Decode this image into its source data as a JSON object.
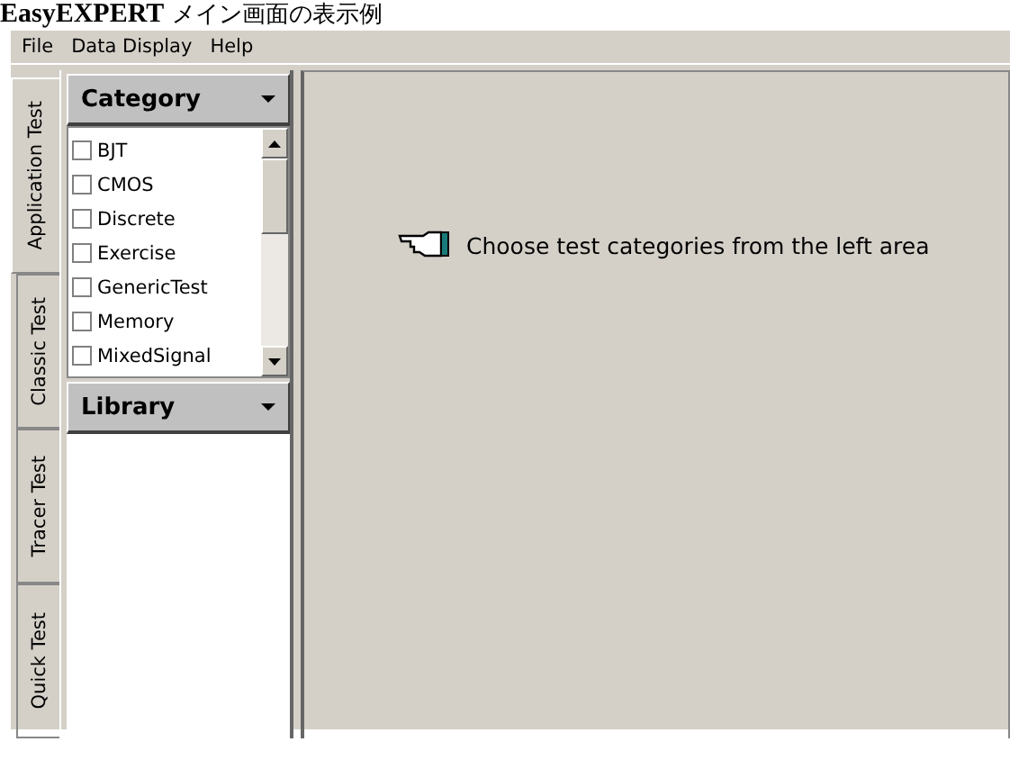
{
  "caption": "**EasyEXPERT** メイン画面の表示例",
  "menu": [
    "File",
    "Data Display",
    "Help"
  ],
  "tabs": [
    {
      "label": "Application Test",
      "selected": true
    },
    {
      "label": "Classic Test",
      "selected": false
    },
    {
      "label": "Tracer Test",
      "selected": false
    },
    {
      "label": "Quick Test",
      "selected": false
    }
  ],
  "category": {
    "title": "Category",
    "items": [
      {
        "label": "BJT",
        "checked": false
      },
      {
        "label": "CMOS",
        "checked": false
      },
      {
        "label": "Discrete",
        "checked": false
      },
      {
        "label": "Exercise",
        "checked": false
      },
      {
        "label": "GenericTest",
        "checked": false
      },
      {
        "label": "Memory",
        "checked": false
      },
      {
        "label": "MixedSignal",
        "checked": false
      }
    ]
  },
  "library": {
    "title": "Library"
  },
  "message": "Choose test categories from the left area"
}
